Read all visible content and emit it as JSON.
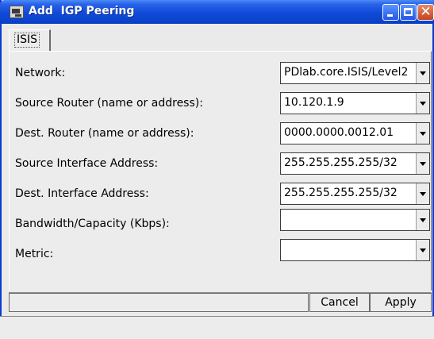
{
  "window": {
    "title": "Add  IGP Peering"
  },
  "tabs": [
    {
      "label": "ISIS"
    }
  ],
  "form": {
    "fields": [
      {
        "label": "Network:",
        "value": "PDlab.core.ISIS/Level2"
      },
      {
        "label": "Source Router (name or address):",
        "value": "10.120.1.9"
      },
      {
        "label": "Dest. Router (name or address):",
        "value": "0000.0000.0012.01"
      },
      {
        "label": "Source Interface Address:",
        "value": "255.255.255.255/32"
      },
      {
        "label": "Dest. Interface Address:",
        "value": "255.255.255.255/32"
      },
      {
        "label": "Bandwidth/Capacity (Kbps):",
        "value": ""
      },
      {
        "label": "Metric:",
        "value": ""
      }
    ]
  },
  "buttons": {
    "cancel": "Cancel",
    "apply": "Apply"
  },
  "icons": {
    "window": "app-window-icon",
    "minimize": "minimize-icon",
    "maximize": "maximize-icon",
    "close": "close-icon",
    "dropdown": "chevron-down-icon"
  },
  "colors": {
    "titlebar": "#0f4bd8",
    "close_button": "#c4441c"
  }
}
